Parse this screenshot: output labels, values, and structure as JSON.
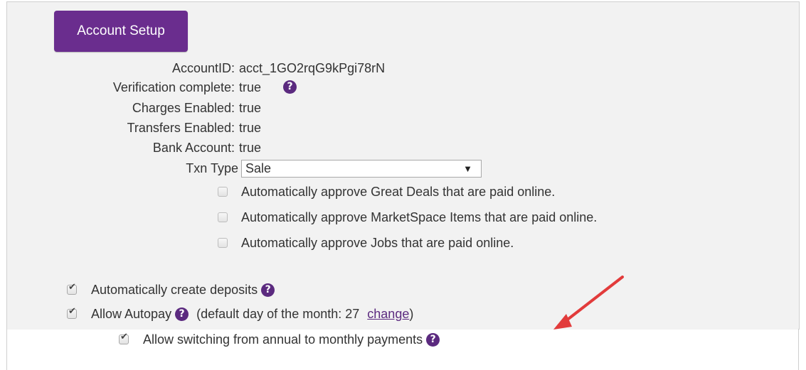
{
  "header": {
    "button_label": "Account Setup"
  },
  "fields": {
    "account_id": {
      "label": "AccountID:",
      "value": "acct_1GO2rqG9kPgi78rN"
    },
    "verification": {
      "label": "Verification complete:",
      "value": "true"
    },
    "charges": {
      "label": "Charges Enabled:",
      "value": "true"
    },
    "transfers": {
      "label": "Transfers Enabled:",
      "value": "true"
    },
    "bank": {
      "label": "Bank Account:",
      "value": "true"
    },
    "txn_type": {
      "label": "Txn Type",
      "selected": "Sale"
    }
  },
  "approvals": [
    {
      "label": "Automatically approve Great Deals that are paid online.",
      "checked": false
    },
    {
      "label": "Automatically approve MarketSpace Items that are paid online.",
      "checked": false
    },
    {
      "label": "Automatically approve Jobs that are paid online.",
      "checked": false
    }
  ],
  "options": {
    "deposits": {
      "label": "Automatically create deposits",
      "checked": true
    },
    "autopay": {
      "label": "Allow Autopay",
      "note_prefix": "(default day of the month: 27",
      "link": "change",
      "note_suffix": ")",
      "checked": true
    },
    "switching": {
      "label": "Allow switching from annual to monthly payments",
      "checked": true
    }
  },
  "icons": {
    "help": "question-circle-icon",
    "annotation": "red-arrow"
  },
  "colors": {
    "accent": "#6a2d8e",
    "annotation": "#e23b3b"
  }
}
